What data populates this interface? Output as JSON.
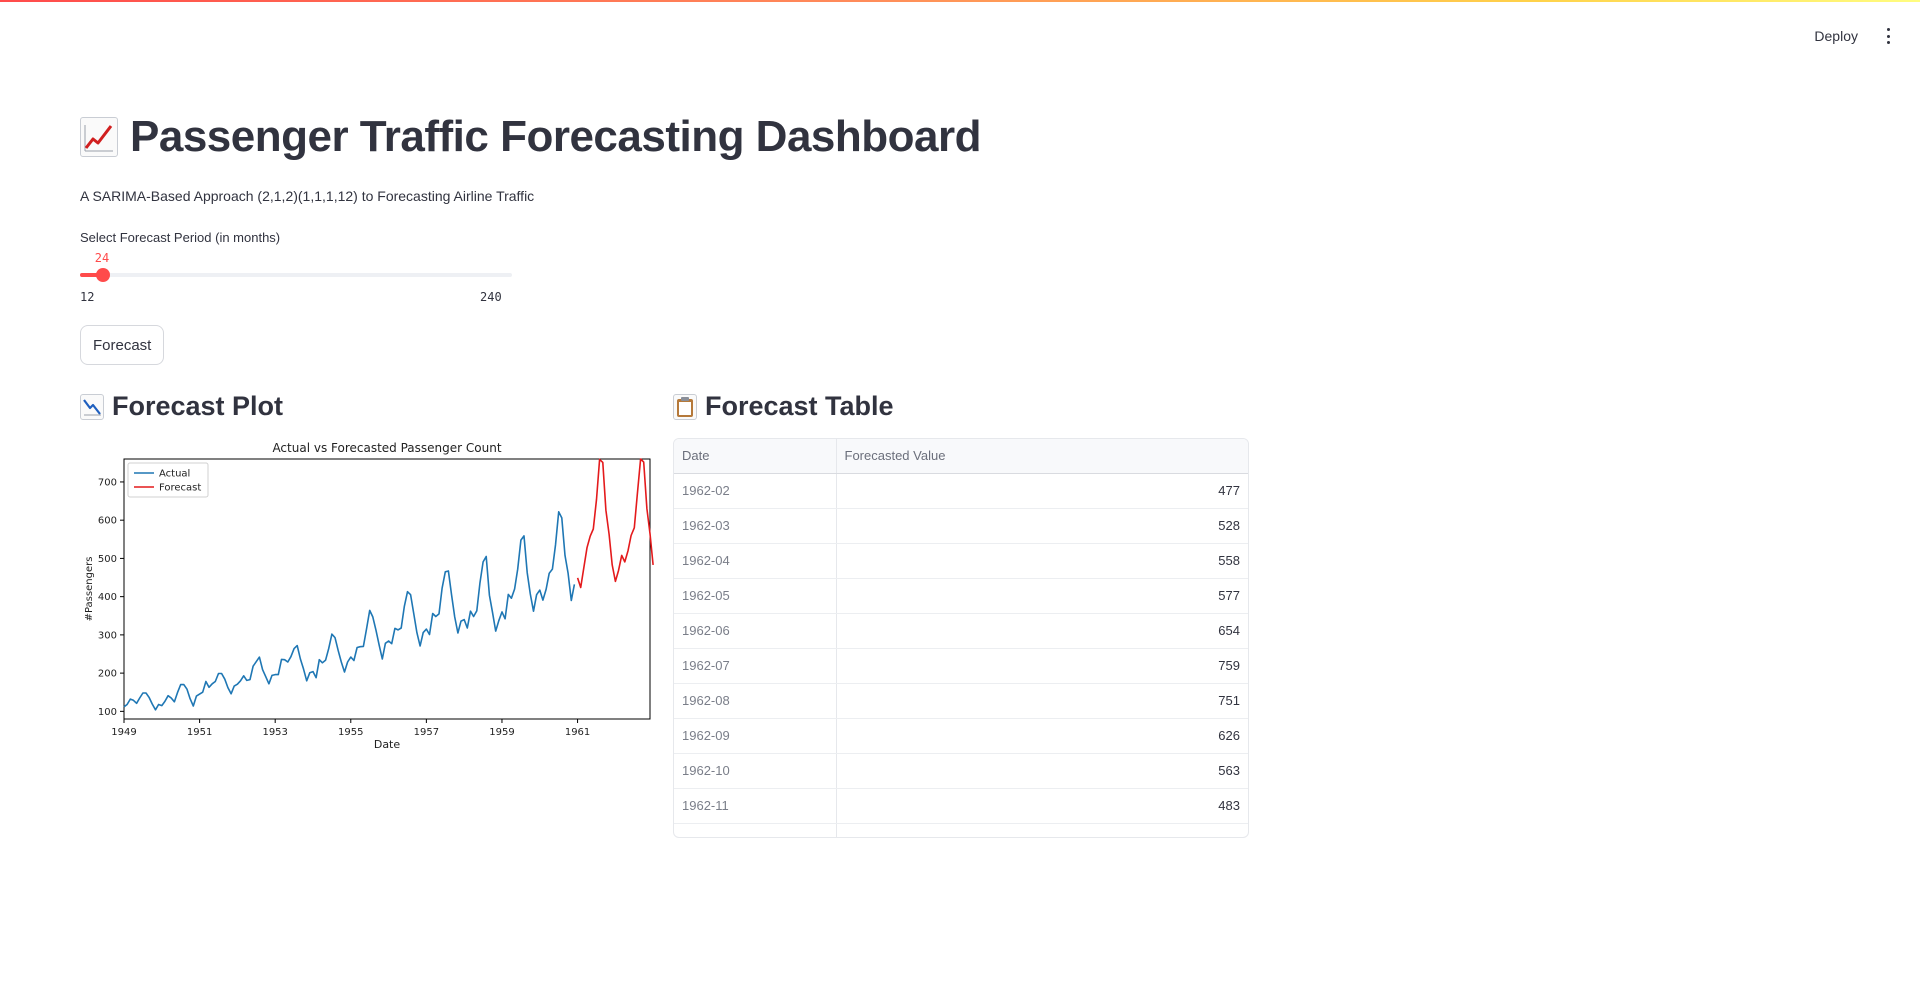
{
  "header": {
    "deploy_label": "Deploy"
  },
  "page": {
    "title": "Passenger Traffic Forecasting Dashboard",
    "subtitle": "A SARIMA-Based Approach (2,1,2)(1,1,1,12) to Forecasting Airline Traffic"
  },
  "slider": {
    "label": "Select Forecast Period (in months)",
    "value": 24,
    "min": 12,
    "max": 240
  },
  "forecast_button": {
    "label": "Forecast"
  },
  "plot_section": {
    "title": "Forecast Plot"
  },
  "table_section": {
    "title": "Forecast Table"
  },
  "table": {
    "columns": [
      "Date",
      "Forecasted Value"
    ],
    "rows": [
      [
        "1962-02",
        "477"
      ],
      [
        "1962-03",
        "528"
      ],
      [
        "1962-04",
        "558"
      ],
      [
        "1962-05",
        "577"
      ],
      [
        "1962-06",
        "654"
      ],
      [
        "1962-07",
        "759"
      ],
      [
        "1962-08",
        "751"
      ],
      [
        "1962-09",
        "626"
      ],
      [
        "1962-10",
        "563"
      ],
      [
        "1962-11",
        "483"
      ]
    ]
  },
  "colors": {
    "accent": "#ff4b4b",
    "actual": "#1f77b4",
    "forecast": "#e41a1c"
  },
  "chart_data": {
    "type": "line",
    "title": "Actual vs Forecasted Passenger Count",
    "xlabel": "Date",
    "ylabel": "#Passengers",
    "xlim": [
      "1949-01",
      "1962-12"
    ],
    "ylim": [
      80,
      760
    ],
    "x_ticks": [
      "1949",
      "1951",
      "1953",
      "1955",
      "1957",
      "1959",
      "1961"
    ],
    "y_ticks": [
      100,
      200,
      300,
      400,
      500,
      600,
      700
    ],
    "legend_position": "top-left",
    "grid": false,
    "series": [
      {
        "name": "Actual",
        "start": "1949-01",
        "frequency": "monthly",
        "values": [
          112,
          118,
          132,
          129,
          121,
          135,
          148,
          148,
          136,
          119,
          104,
          118,
          115,
          126,
          141,
          135,
          125,
          149,
          170,
          170,
          158,
          133,
          114,
          140,
          145,
          150,
          178,
          163,
          172,
          178,
          199,
          199,
          184,
          162,
          146,
          166,
          171,
          180,
          193,
          181,
          183,
          218,
          230,
          242,
          209,
          191,
          172,
          194,
          196,
          196,
          236,
          235,
          229,
          243,
          264,
          272,
          237,
          211,
          180,
          201,
          204,
          188,
          235,
          227,
          234,
          264,
          302,
          293,
          259,
          229,
          203,
          229,
          242,
          233,
          267,
          269,
          270,
          315,
          364,
          347,
          312,
          274,
          237,
          278,
          284,
          277,
          317,
          313,
          318,
          374,
          413,
          405,
          355,
          306,
          271,
          306,
          315,
          301,
          356,
          348,
          355,
          422,
          465,
          467,
          404,
          347,
          305,
          336,
          340,
          318,
          362,
          348,
          363,
          435,
          491,
          505,
          404,
          359,
          310,
          337,
          360,
          342,
          406,
          396,
          420,
          472,
          548,
          559,
          463,
          407,
          362,
          405,
          417,
          391,
          419,
          461,
          472,
          535,
          622,
          606,
          508,
          461,
          390,
          432
        ]
      },
      {
        "name": "Forecast",
        "start": "1961-01",
        "frequency": "monthly",
        "values": [
          449,
          424,
          477,
          528,
          558,
          577,
          654,
          759,
          751,
          626,
          563,
          483,
          440,
          468,
          508,
          491,
          520,
          560,
          580,
          670,
          760,
          752,
          630,
          565,
          483
        ]
      }
    ]
  }
}
